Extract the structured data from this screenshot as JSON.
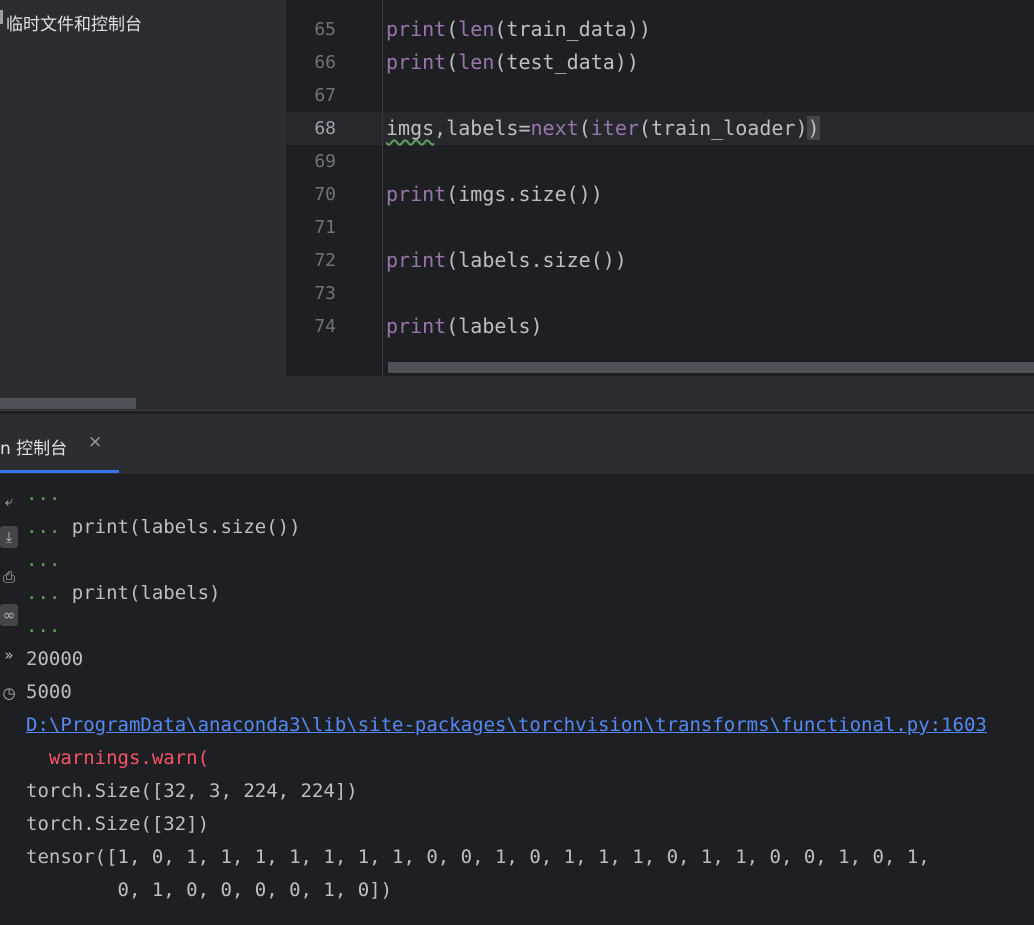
{
  "project_panel": {
    "scratch_label": "临时文件和控制台"
  },
  "editor": {
    "lines": [
      {
        "num": "65",
        "pre": "",
        "fn": "print",
        "post": "(",
        "fn2": "len",
        "rest": "(train_data))"
      },
      {
        "num": "66",
        "pre": "",
        "fn": "print",
        "post": "(",
        "fn2": "len",
        "rest": "(test_data))"
      },
      {
        "num": "67"
      },
      {
        "num": "68"
      },
      {
        "num": "69"
      },
      {
        "num": "70",
        "fn": "print",
        "rest": "(imgs.size())"
      },
      {
        "num": "71"
      },
      {
        "num": "72",
        "fn": "print",
        "rest": "(labels.size())"
      },
      {
        "num": "73"
      },
      {
        "num": "74",
        "fn": "print",
        "rest": "(labels)"
      }
    ],
    "line68": {
      "imgs": "imgs",
      "comma_labels": ",labels",
      "eq": "=",
      "next": "next",
      "open": "(",
      "iter": "iter",
      "arg": "(train_loader)",
      "close": ")"
    }
  },
  "console": {
    "tab_label": "n 控制台",
    "close_glyph": "×",
    "lines": [
      {
        "type": "prompt",
        "prompt": "...",
        "text": ""
      },
      {
        "type": "prompt",
        "prompt": "...",
        "text": " print(labels.size())"
      },
      {
        "type": "prompt",
        "prompt": "...",
        "text": ""
      },
      {
        "type": "prompt",
        "prompt": "...",
        "text": " print(labels)"
      },
      {
        "type": "prompt",
        "prompt": "...",
        "text": ""
      },
      {
        "type": "out",
        "text": "20000"
      },
      {
        "type": "out",
        "text": "5000"
      },
      {
        "type": "link",
        "text": "D:\\ProgramData\\anaconda3\\lib\\site-packages\\torchvision\\transforms\\functional.py:1603"
      },
      {
        "type": "err",
        "text": "  warnings.warn("
      },
      {
        "type": "out",
        "text": "torch.Size([32, 3, 224, 224])"
      },
      {
        "type": "out",
        "text": "torch.Size([32])"
      },
      {
        "type": "out",
        "text": "tensor([1, 0, 1, 1, 1, 1, 1, 1, 1, 0, 0, 1, 0, 1, 1, 1, 0, 1, 1, 0, 0, 1, 0, 1,"
      },
      {
        "type": "out",
        "text": "        0, 1, 0, 0, 0, 0, 1, 0])"
      }
    ],
    "toolbar_icons": [
      "soft-wrap-icon",
      "scroll-to-end-icon",
      "print-icon",
      "glasses-icon",
      "more-icon",
      "history-icon"
    ]
  },
  "colors": {
    "accent": "#3574f0",
    "function": "#9876aa",
    "prompt": "#5fa05f",
    "link": "#548af7",
    "error": "#f75464"
  }
}
